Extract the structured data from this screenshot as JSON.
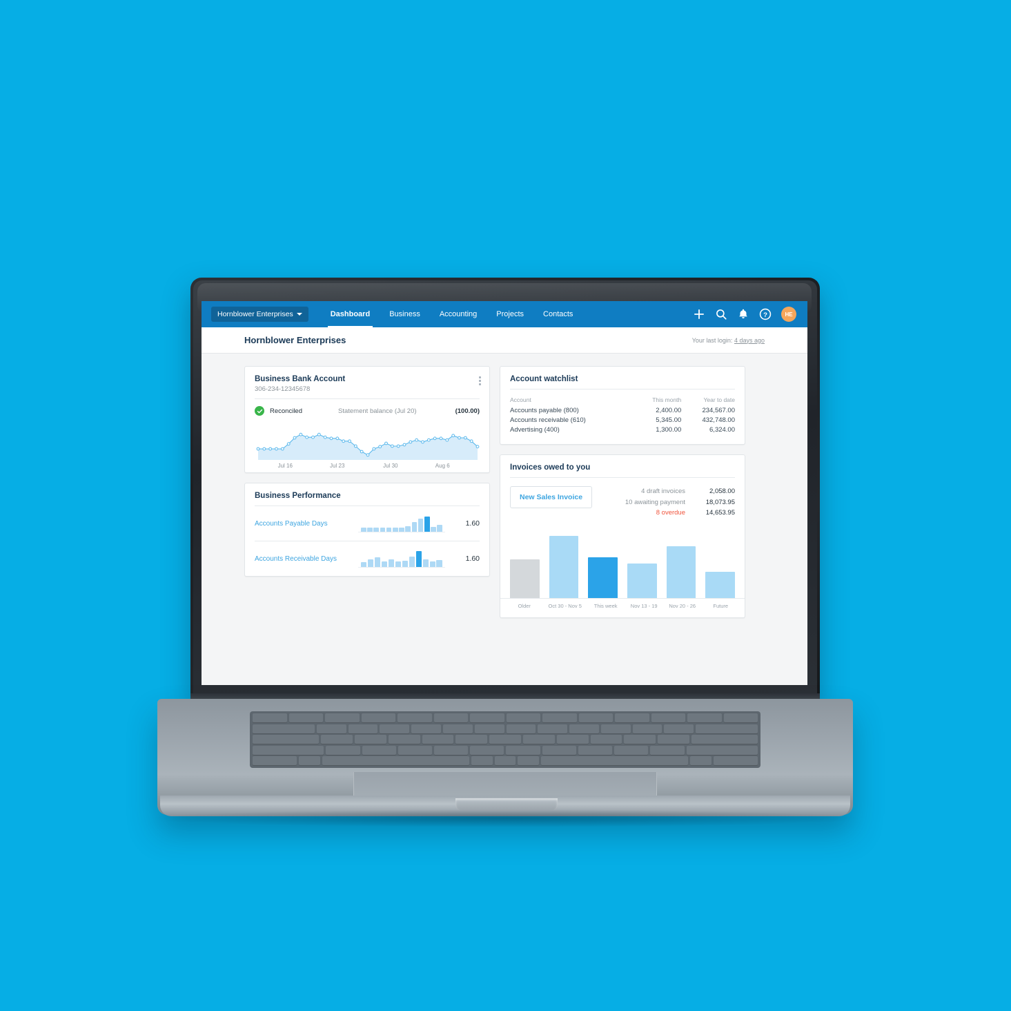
{
  "navbar": {
    "org_button": "Hornblower Enterprises",
    "caret_icon": "chevron-down-icon",
    "links": [
      {
        "label": "Dashboard",
        "active": true
      },
      {
        "label": "Business",
        "active": false
      },
      {
        "label": "Accounting",
        "active": false
      },
      {
        "label": "Projects",
        "active": false
      },
      {
        "label": "Contacts",
        "active": false
      }
    ],
    "icons": [
      "plus-icon",
      "search-icon",
      "bell-icon",
      "help-icon"
    ],
    "avatar_initials": "HE",
    "colors": {
      "navbar_bg": "#0f7dc2",
      "org_btn_bg": "#106398",
      "avatar_bg": "#f5a65b"
    }
  },
  "subheader": {
    "org_title": "Hornblower Enterprises",
    "last_login_prefix": "Your last login:",
    "last_login_link": "4 days ago"
  },
  "bank_card": {
    "title": "Business Bank Account",
    "account_number": "306-234-12345678",
    "menu_icon": "kebab-menu-icon",
    "status_icon": "check-circle-icon",
    "status_label": "Reconciled",
    "statement_label": "Statement balance (Jul 20)",
    "statement_value": "(100.00)"
  },
  "performance_card": {
    "title": "Business Performance",
    "rows": [
      {
        "label": "Accounts Payable Days",
        "value": "1.60"
      },
      {
        "label": "Accounts Receivable Days",
        "value": "1.60"
      }
    ]
  },
  "watchlist_card": {
    "title": "Account watchlist",
    "columns": [
      "Account",
      "This month",
      "Year to date"
    ],
    "rows": [
      {
        "account": "Accounts payable (800)",
        "this_month": "2,400.00",
        "ytd": "234,567.00"
      },
      {
        "account": "Accounts receivable (610)",
        "this_month": "5,345.00",
        "ytd": "432,748.00"
      },
      {
        "account": "Advertising (400)",
        "this_month": "1,300.00",
        "ytd": "6,324.00"
      }
    ]
  },
  "invoices_card": {
    "title": "Invoices owed to you",
    "new_invoice_button": "New Sales Invoice",
    "stats": [
      {
        "label": "4 draft invoices",
        "amount": "2,058.00",
        "overdue": false
      },
      {
        "label": "10 awaiting payment",
        "amount": "18,073.95",
        "overdue": false
      },
      {
        "label": "8 overdue",
        "amount": "14,653.95",
        "overdue": true
      }
    ]
  },
  "chart_data": [
    {
      "type": "area",
      "name": "bank-account-balance-sparkline",
      "title": "Business Bank Account balance",
      "xlabel": "",
      "ylabel": "",
      "grid": false,
      "legend": "none",
      "tick_labels": [
        "Jul 16",
        "Jul 23",
        "Jul 30",
        "Aug 6"
      ],
      "tick_positions": [
        0.135,
        0.365,
        0.6,
        0.83
      ],
      "values": [
        30,
        30,
        30,
        30,
        30,
        48,
        70,
        82,
        72,
        72,
        82,
        72,
        68,
        68,
        58,
        58,
        40,
        20,
        8,
        30,
        38,
        50,
        40,
        40,
        45,
        55,
        62,
        55,
        62,
        68,
        68,
        62,
        78,
        70,
        70,
        58,
        38
      ],
      "ylim": [
        0,
        100
      ],
      "line_color": "#5ab8ec",
      "fill_color": "#d7ecfa"
    },
    {
      "type": "bar",
      "name": "accounts-payable-days-sparkline",
      "title": "Accounts Payable Days",
      "categories": [
        "1",
        "2",
        "3",
        "4",
        "5",
        "6",
        "7",
        "8",
        "9",
        "10",
        "11",
        "12"
      ],
      "values": [
        22,
        24,
        24,
        24,
        24,
        24,
        24,
        30,
        52,
        72,
        85,
        28,
        40
      ],
      "highlight_index": 10,
      "ylim": [
        0,
        100
      ],
      "bar_color": "#aed9f5",
      "highlight_color": "#2ba3e8"
    },
    {
      "type": "bar",
      "name": "accounts-receivable-days-sparkline",
      "title": "Accounts Receivable Days",
      "categories": [
        "1",
        "2",
        "3",
        "4",
        "5",
        "6",
        "7",
        "8",
        "9",
        "10",
        "11",
        "12"
      ],
      "values": [
        26,
        42,
        52,
        32,
        42,
        32,
        34,
        56,
        88,
        44,
        30,
        40
      ],
      "highlight_index": 8,
      "ylim": [
        0,
        100
      ],
      "bar_color": "#aed9f5",
      "highlight_color": "#2ba3e8"
    },
    {
      "type": "bar",
      "name": "invoices-owed-bar-chart",
      "title": "Invoices owed to you",
      "categories": [
        "Older",
        "Oct 30 - Nov 5",
        "This week",
        "Nov 13 - 19",
        "Nov 20 - 26",
        "Future"
      ],
      "values": [
        53,
        86,
        56,
        48,
        72,
        36
      ],
      "ylim": [
        0,
        100
      ],
      "bar_colors": [
        "#d4d8db",
        "#a9daf6",
        "#2ba3e8",
        "#a9daf6",
        "#a9daf6",
        "#a9daf6"
      ],
      "xlabel": "",
      "ylabel": "",
      "grid": false,
      "legend": "none"
    }
  ]
}
